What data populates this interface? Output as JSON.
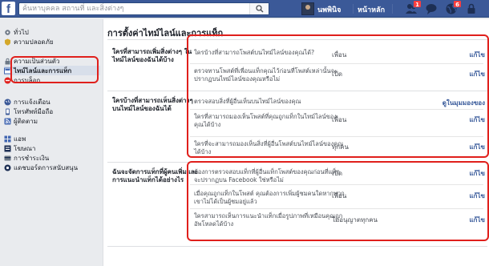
{
  "topbar": {
    "logo": "f",
    "search_placeholder": "ค้นหาบุคคล สถานที่ และสิ่งต่างๆ",
    "profile_name": "นพพินิจ",
    "home_label": "หน้าหลัก",
    "friend_requests_count": "1",
    "notifications_count": "6",
    "colors": {
      "bar": "#3b5998",
      "badge": "#fa3e3e"
    }
  },
  "sidebar": {
    "items": [
      {
        "label": "ทั่วไป",
        "icon": "gear-icon"
      },
      {
        "label": "ความปลอดภัย",
        "icon": "shield-icon"
      },
      {
        "label": "ความเป็นส่วนตัว",
        "icon": "lock-icon"
      },
      {
        "label": "ไทม์ไลน์และการแท็ก",
        "icon": "timeline-icon",
        "selected": true
      },
      {
        "label": "การบล็อก",
        "icon": "block-icon"
      },
      {
        "label": "การแจ้งเตือน",
        "icon": "globe-icon"
      },
      {
        "label": "โทรศัพท์มือถือ",
        "icon": "phone-icon"
      },
      {
        "label": "ผู้ติดตาม",
        "icon": "rss-icon"
      },
      {
        "label": "แอพ",
        "icon": "apps-icon"
      },
      {
        "label": "โฆษณา",
        "icon": "ads-icon"
      },
      {
        "label": "การชำระเงิน",
        "icon": "card-icon"
      },
      {
        "label": "แดชบอร์ดการสนับสนุน",
        "icon": "support-icon"
      }
    ]
  },
  "main": {
    "title": "การตั้งค่าไทม์ไลน์และการแท็ก",
    "sections": [
      {
        "label": "ใครที่สามารถเพิ่มสิ่งต่างๆ ในไทม์ไลน์ของฉันได้บ้าง",
        "rows": [
          {
            "question": "ใครบ้างที่สามารถโพสต์บนไทม์ไลน์ของคุณได้?",
            "value": "เพื่อน",
            "edit": "แก้ไข"
          },
          {
            "question": "ตรวจทานโพสต์ที่เพื่อนแท็กคุณไว้ก่อนที่โพสต์เหล่านั้นจะปรากฏบนไทม์ไลน์ของคุณหรือไม่",
            "value": "เปิด",
            "edit": "แก้ไข"
          }
        ]
      },
      {
        "label": "ใครบ้างที่สามารถเห็นสิ่งต่างๆ บนไทม์ไลน์ของฉันได้",
        "rows": [
          {
            "question": "ตรวจสอบสิ่งที่ผู้อื่นเห็นบนไทม์ไลน์ของคุณ",
            "value": "",
            "edit": "ดูในมุมมองของ"
          },
          {
            "question": "ใครที่สามารถมองเห็นโพสต์ที่คุณถูกแท็กในไทม์ไลน์ของคุณได้บ้าง",
            "value": "เพื่อน",
            "edit": "แก้ไข"
          },
          {
            "question": "ใครที่จะสามารถมองเห็นสิ่งที่ผู้อื่นโพสต์บนไทม์ไลน์ของคุณได้บ้าง",
            "value": "ทุกคน",
            "edit": "แก้ไข"
          }
        ]
      },
      {
        "label": "ฉันจะจัดการแท็กที่ผู้คนเพิ่มและการแนะนำแท็กได้อย่างไร",
        "rows": [
          {
            "question": "ต้องการตรวจสอบแท็กที่ผู้อื่นแท็กโพสต์ของคุณก่อนที่แท็กจะปรากฏบน Facebook ใช่หรือไม่",
            "value": "เปิด",
            "edit": "แก้ไข"
          },
          {
            "question": "เมื่อคุณถูกแท็กในโพสต์ คุณต้องการเพิ่มผู้ชมคนใดหากพวกเขาไม่ได้เป็นผู้ชมอยู่แล้ว",
            "value": "เพื่อน",
            "edit": "แก้ไข"
          },
          {
            "question": "ใครสามารถเห็นการแนะนำแท็กเมื่อรูปภาพที่เหมือนคุณถูกอัพโหลดได้บ้าง",
            "value": "ไม่อนุญาตทุกคน",
            "edit": "แก้ไข"
          }
        ]
      }
    ]
  },
  "annotation_color": "#e0201c"
}
